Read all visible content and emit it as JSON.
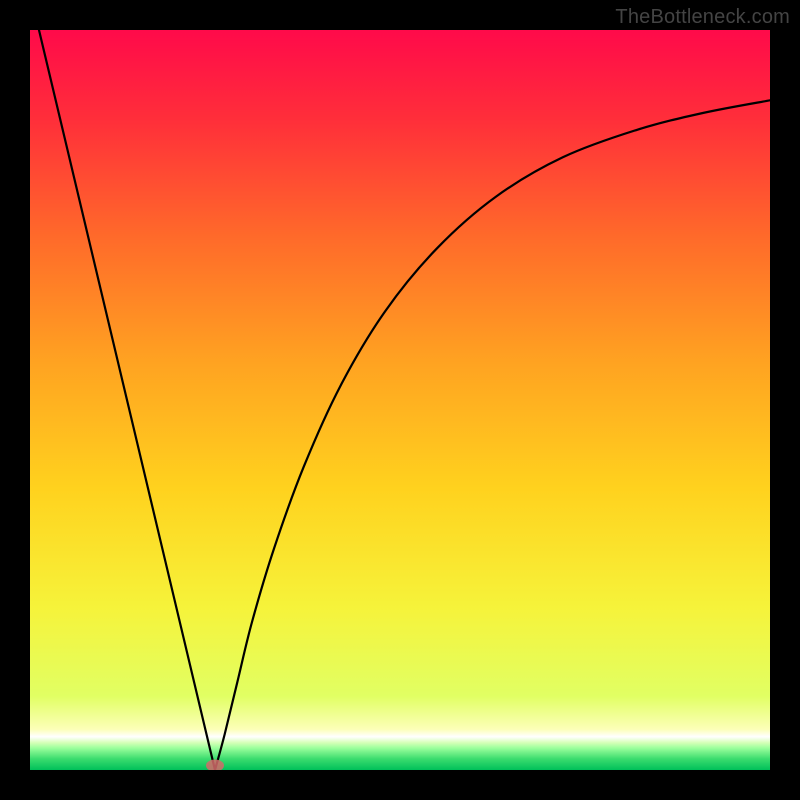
{
  "attribution": "TheBottleneck.com",
  "chart_data": {
    "type": "line",
    "title": "",
    "xlabel": "",
    "ylabel": "",
    "xlim": [
      0,
      1
    ],
    "ylim": [
      0,
      1
    ],
    "notch_x": 0.25,
    "marker": {
      "x": 0.25,
      "y": 0.006,
      "color": "#d46a6a",
      "rx": 9,
      "ry": 6
    },
    "curve_points": [
      {
        "x": 0.005,
        "y": 1.03
      },
      {
        "x": 0.25,
        "y": 0.0
      },
      {
        "x": 0.263,
        "y": 0.048
      },
      {
        "x": 0.28,
        "y": 0.118
      },
      {
        "x": 0.3,
        "y": 0.2
      },
      {
        "x": 0.33,
        "y": 0.3
      },
      {
        "x": 0.37,
        "y": 0.41
      },
      {
        "x": 0.42,
        "y": 0.52
      },
      {
        "x": 0.48,
        "y": 0.62
      },
      {
        "x": 0.55,
        "y": 0.705
      },
      {
        "x": 0.63,
        "y": 0.775
      },
      {
        "x": 0.72,
        "y": 0.828
      },
      {
        "x": 0.82,
        "y": 0.865
      },
      {
        "x": 0.91,
        "y": 0.888
      },
      {
        "x": 1.0,
        "y": 0.905
      }
    ],
    "gradient_stops": [
      {
        "offset": 0.0,
        "color": "#ff0a4a"
      },
      {
        "offset": 0.12,
        "color": "#ff2e3a"
      },
      {
        "offset": 0.28,
        "color": "#ff6a2a"
      },
      {
        "offset": 0.45,
        "color": "#ffa321"
      },
      {
        "offset": 0.62,
        "color": "#ffd21e"
      },
      {
        "offset": 0.78,
        "color": "#f6f33a"
      },
      {
        "offset": 0.9,
        "color": "#e1ff63"
      },
      {
        "offset": 0.945,
        "color": "#fcffb8"
      },
      {
        "offset": 0.955,
        "color": "#ffffff"
      },
      {
        "offset": 0.963,
        "color": "#d6ffb8"
      },
      {
        "offset": 0.97,
        "color": "#9dff9d"
      },
      {
        "offset": 0.985,
        "color": "#3bdc6e"
      },
      {
        "offset": 1.0,
        "color": "#00c05a"
      }
    ]
  }
}
